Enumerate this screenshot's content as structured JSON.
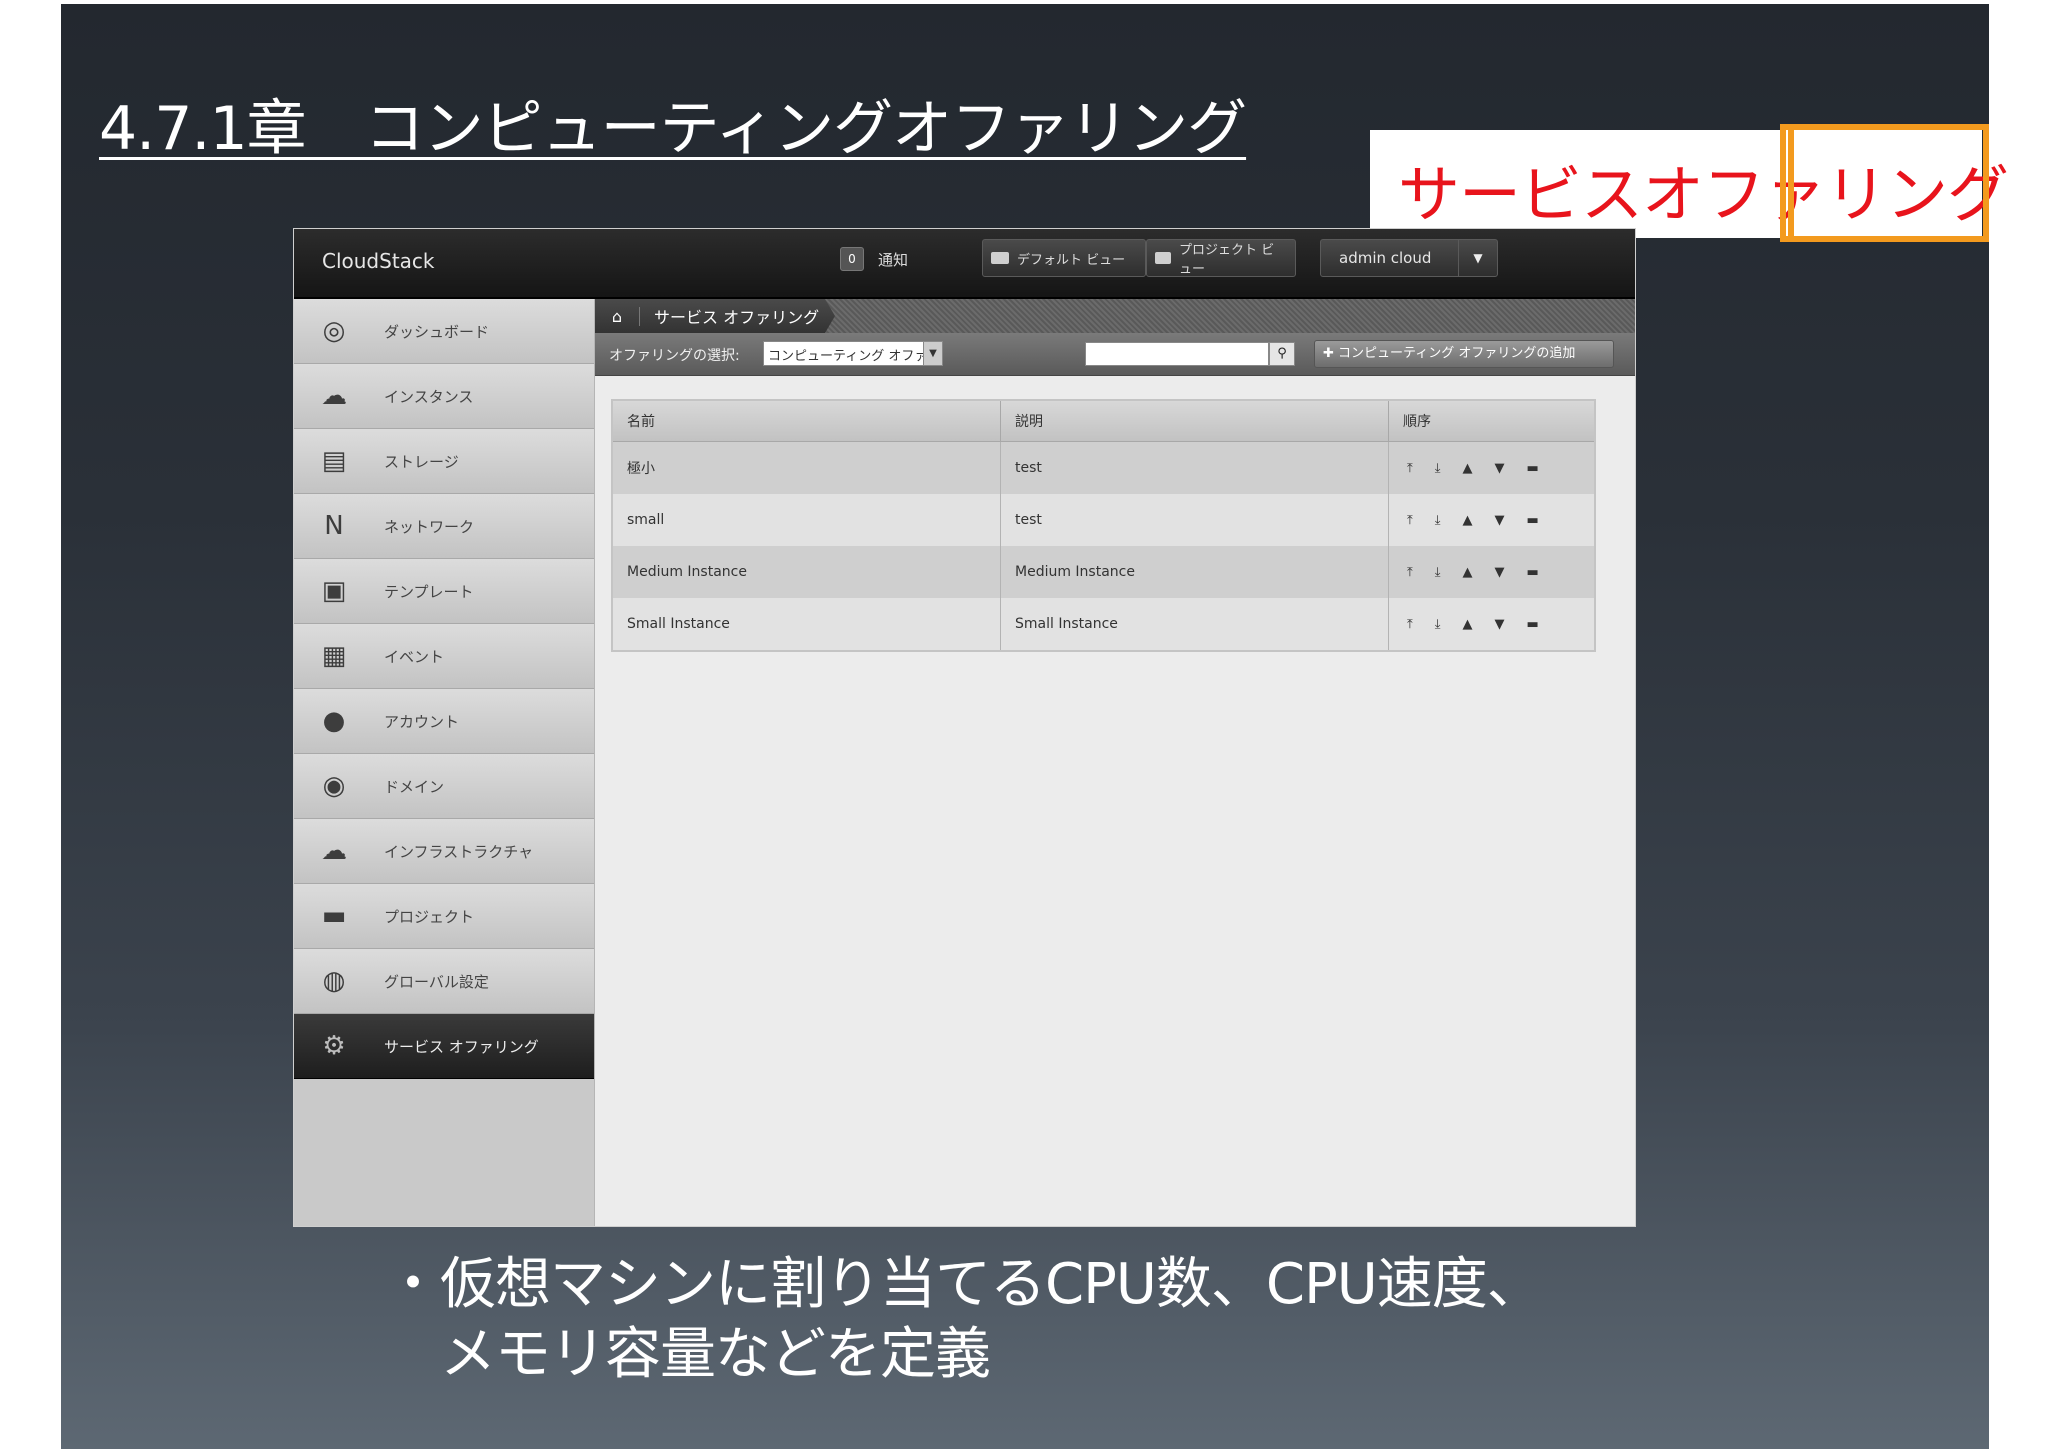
{
  "slide": {
    "title": "4.7.1章　コンピューティングオファリング",
    "callout": "サービスオファリング",
    "bullet_line1": "・仮想マシンに割り当てるCPU数、CPU速度、",
    "bullet_line2": "　メモリ容量などを定義"
  },
  "app": {
    "logo": "CloudStack",
    "notification_count": "0",
    "notification_label": "通知",
    "default_view": "デフォルト ビュー",
    "project_view": "プロジェクト ビュー",
    "user": "admin cloud"
  },
  "sidebar": {
    "items": [
      {
        "label": "ダッシュボード",
        "icon": "dashboard-icon"
      },
      {
        "label": "インスタンス",
        "icon": "cloud-icon"
      },
      {
        "label": "ストレージ",
        "icon": "storage-icon"
      },
      {
        "label": "ネットワーク",
        "icon": "network-icon"
      },
      {
        "label": "テンプレート",
        "icon": "template-icon"
      },
      {
        "label": "イベント",
        "icon": "calendar-icon"
      },
      {
        "label": "アカウント",
        "icon": "user-icon"
      },
      {
        "label": "ドメイン",
        "icon": "domain-icon"
      },
      {
        "label": "インフラストラクチャ",
        "icon": "infrastructure-icon"
      },
      {
        "label": "プロジェクト",
        "icon": "folder-icon"
      },
      {
        "label": "グローバル設定",
        "icon": "globe-icon"
      },
      {
        "label": "サービス オファリング",
        "icon": "gear-icon",
        "active": true
      }
    ]
  },
  "breadcrumb": {
    "current": "サービス オファリング"
  },
  "toolbar": {
    "select_label": "オファリングの選択:",
    "select_value": "コンピューティング オファ",
    "search_value": "",
    "add_button": "コンピューティング オファリングの追加"
  },
  "table": {
    "headers": [
      "名前",
      "説明",
      "順序"
    ],
    "rows": [
      {
        "name": "極小",
        "description": "test"
      },
      {
        "name": "small",
        "description": "test"
      },
      {
        "name": "Medium Instance",
        "description": "Medium Instance"
      },
      {
        "name": "Small Instance",
        "description": "Small Instance"
      }
    ],
    "order_icons": [
      "move-top-icon",
      "move-bottom-icon",
      "move-up-icon",
      "move-down-icon",
      "drag-icon"
    ]
  }
}
